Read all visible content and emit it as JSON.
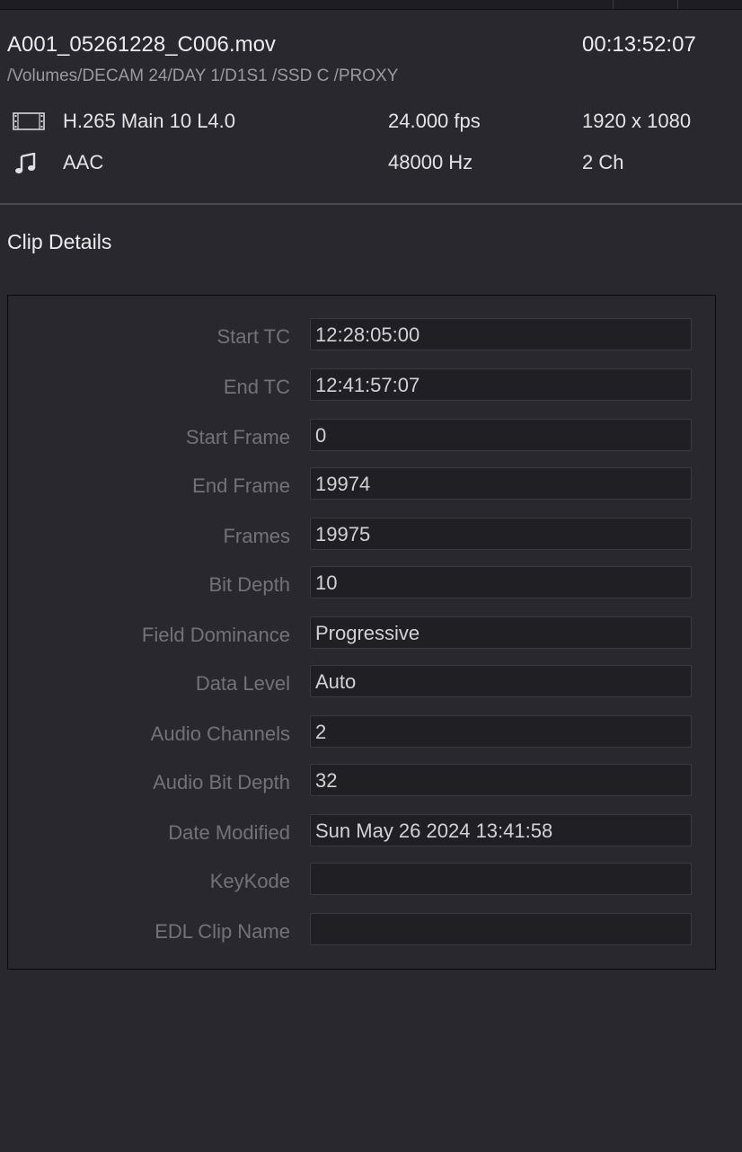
{
  "clip": {
    "filename": "A001_05261228_C006.mov",
    "duration": "00:13:52:07",
    "path": "/Volumes/DECAM 24/DAY 1/D1S1 /SSD C /PROXY"
  },
  "video": {
    "icon": "film-strip-icon",
    "codec": "H.265 Main 10 L4.0",
    "fps": "24.000 fps",
    "resolution": "1920 x 1080"
  },
  "audio": {
    "icon": "music-note-icon",
    "codec": "AAC",
    "sample_rate": "48000 Hz",
    "channels": "2 Ch"
  },
  "details": {
    "title": "Clip Details",
    "fields": [
      {
        "label": "Start TC",
        "value": "12:28:05:00"
      },
      {
        "label": "End TC",
        "value": "12:41:57:07"
      },
      {
        "label": "Start Frame",
        "value": "0"
      },
      {
        "label": "End Frame",
        "value": "19974"
      },
      {
        "label": "Frames",
        "value": "19975"
      },
      {
        "label": "Bit Depth",
        "value": "10"
      },
      {
        "label": "Field Dominance",
        "value": "Progressive"
      },
      {
        "label": "Data Level",
        "value": "Auto"
      },
      {
        "label": "Audio Channels",
        "value": "2"
      },
      {
        "label": "Audio Bit Depth",
        "value": "32"
      },
      {
        "label": "Date Modified",
        "value": "Sun May 26 2024 13:41:58"
      },
      {
        "label": "KeyKode",
        "value": ""
      },
      {
        "label": "EDL Clip Name",
        "value": ""
      }
    ]
  },
  "colors": {
    "background": "#28282e",
    "text_primary": "#ececec",
    "text_label": "#727278",
    "field_bg": "#1f1f24"
  }
}
